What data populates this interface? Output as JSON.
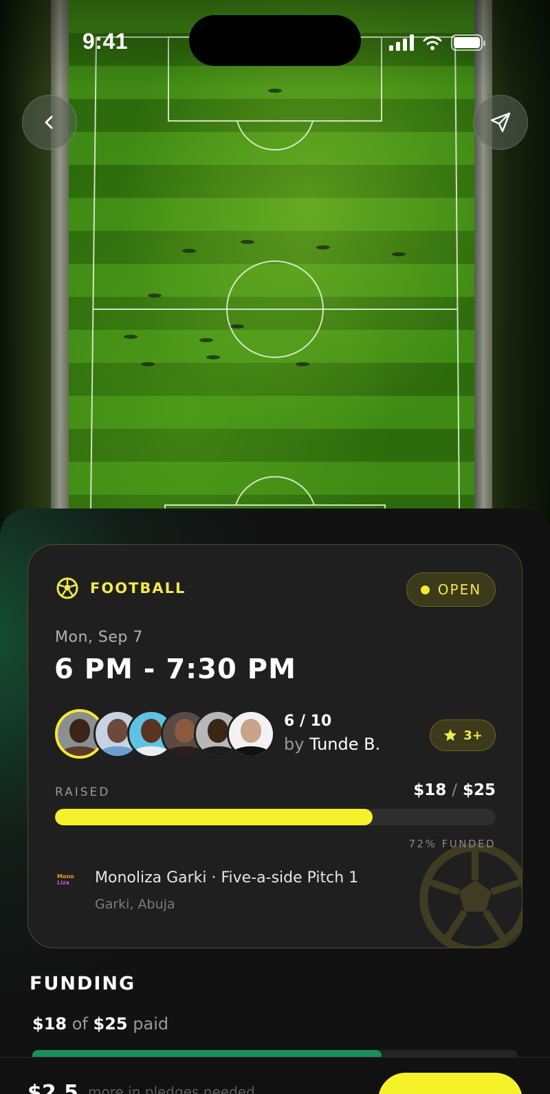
{
  "status_bar": {
    "time": "9:41"
  },
  "hero": {
    "image_description": ""
  },
  "game": {
    "sport": "FOOTBALL",
    "status": "OPEN",
    "date": "Mon, Sep 7",
    "time_range": "6 PM - 7:30 PM",
    "players_count": "6 / 10",
    "host_prefix": "by",
    "host_name": "Tunde B.",
    "rating": "3+",
    "raised_label": "RAISED",
    "raised_current": "$18",
    "raised_separator": "/",
    "raised_target": "$25",
    "raised_fraction": 0.72,
    "funded_label": "72% FUNDED",
    "venue_logo_line1": "Mono",
    "venue_logo_line2": "Liza",
    "venue_name": "Monoliza Garki · Five-a-side Pitch 1",
    "venue_city": "Garki, Abuja"
  },
  "funding": {
    "title": "FUNDING",
    "paid": "$18",
    "of": "of",
    "total": "$25",
    "paid_suffix": "paid",
    "fraction": 0.72
  },
  "bottom_bar": {
    "pledge_amount": "$2.5",
    "pledge_text": "more in pledges needed"
  },
  "colors": {
    "accent_yellow": "#f6f22a",
    "accent_green": "#1a8f5c",
    "background": "#121212",
    "card": "#1f1f1f"
  },
  "icons": {
    "back": "chevron-left-icon",
    "share": "send-icon",
    "sport": "soccer-ball-icon",
    "rating": "star-icon"
  }
}
